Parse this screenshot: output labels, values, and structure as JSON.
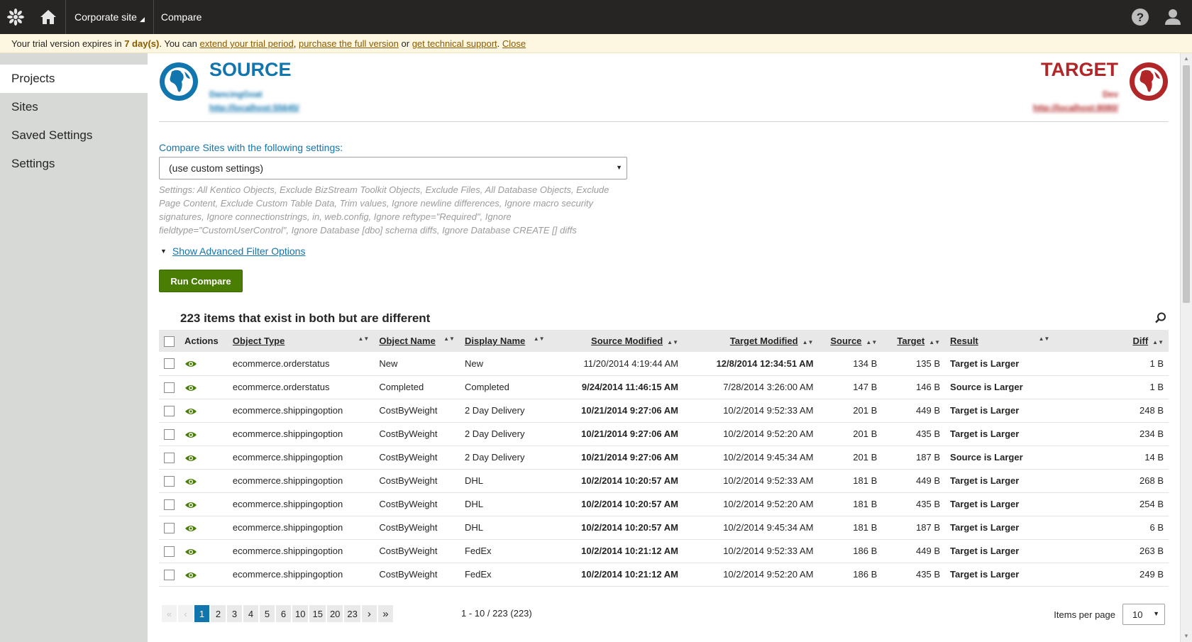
{
  "topbar": {
    "logo_icon": "kentico-logo-icon",
    "home_icon": "home-icon",
    "site_label": "Corporate site",
    "app_label": "Compare",
    "help_icon": "help-icon",
    "user_icon": "user-icon"
  },
  "trial": {
    "prefix": "Your trial version expires in ",
    "days": "7 day(s)",
    "middle": ". You can ",
    "link_extend": "extend your trial period",
    "sep1": ", ",
    "link_purchase": "purchase the full version",
    "sep2": " or ",
    "link_support": "get technical support",
    "sep3": ". ",
    "link_close": "Close"
  },
  "sidebar": {
    "items": [
      {
        "label": "Projects",
        "active": true
      },
      {
        "label": "Sites",
        "active": false
      },
      {
        "label": "Saved Settings",
        "active": false
      },
      {
        "label": "Settings",
        "active": false
      }
    ]
  },
  "source": {
    "title": "SOURCE",
    "name": "DancingGoat",
    "url": "http://localhost:55645/",
    "color": "#1175ae"
  },
  "target": {
    "title": "TARGET",
    "name": "Dev",
    "url": "http://localhost:8080/",
    "color": "#b12628"
  },
  "compare": {
    "label": "Compare Sites with the following settings:",
    "selected": "(use custom settings)",
    "settings_text": "Settings: All Kentico Objects, Exclude BizStream Toolkit Objects, Exclude Files, All Database Objects, Exclude Page Content, Exclude Custom Table Data, Trim values, Ignore newline differences, Ignore macro security signatures, Ignore connectionstrings, in, web.config, Ignore reftype=\"Required\", Ignore fieldtype=\"CustomUserControl\", Ignore Database [dbo] schema diffs, Ignore Database CREATE [] diffs",
    "advanced_link": "Show Advanced Filter Options",
    "run_button": "Run Compare"
  },
  "grid": {
    "title": "223 items that exist in both but are different",
    "columns": {
      "actions": "Actions",
      "object_type": "Object Type",
      "object_name": "Object Name",
      "display_name": "Display Name",
      "source_modified": "Source Modified",
      "target_modified": "Target Modified",
      "source": "Source",
      "target": "Target",
      "result": "Result",
      "diff": "Diff"
    },
    "rows": [
      {
        "object_type": "ecommerce.orderstatus",
        "object_name": "New",
        "display_name": "New",
        "source_modified": "11/20/2014 4:19:44 AM",
        "target_modified": "12/8/2014 12:34:51 AM",
        "newer": "target",
        "source": "134 B",
        "target": "135 B",
        "result": "Target is Larger",
        "diff": "1 B"
      },
      {
        "object_type": "ecommerce.orderstatus",
        "object_name": "Completed",
        "display_name": "Completed",
        "source_modified": "9/24/2014 11:46:15 AM",
        "target_modified": "7/28/2014 3:26:00 AM",
        "newer": "source",
        "source": "147 B",
        "target": "146 B",
        "result": "Source is Larger",
        "diff": "1 B"
      },
      {
        "object_type": "ecommerce.shippingoption",
        "object_name": "CostByWeight",
        "display_name": "2 Day Delivery",
        "source_modified": "10/21/2014 9:27:06 AM",
        "target_modified": "10/2/2014 9:52:33 AM",
        "newer": "source",
        "source": "201 B",
        "target": "449 B",
        "result": "Target is Larger",
        "diff": "248 B"
      },
      {
        "object_type": "ecommerce.shippingoption",
        "object_name": "CostByWeight",
        "display_name": "2 Day Delivery",
        "source_modified": "10/21/2014 9:27:06 AM",
        "target_modified": "10/2/2014 9:52:20 AM",
        "newer": "source",
        "source": "201 B",
        "target": "435 B",
        "result": "Target is Larger",
        "diff": "234 B"
      },
      {
        "object_type": "ecommerce.shippingoption",
        "object_name": "CostByWeight",
        "display_name": "2 Day Delivery",
        "source_modified": "10/21/2014 9:27:06 AM",
        "target_modified": "10/2/2014 9:45:34 AM",
        "newer": "source",
        "source": "201 B",
        "target": "187 B",
        "result": "Source is Larger",
        "diff": "14 B"
      },
      {
        "object_type": "ecommerce.shippingoption",
        "object_name": "CostByWeight",
        "display_name": "DHL",
        "source_modified": "10/2/2014 10:20:57 AM",
        "target_modified": "10/2/2014 9:52:33 AM",
        "newer": "source",
        "source": "181 B",
        "target": "449 B",
        "result": "Target is Larger",
        "diff": "268 B"
      },
      {
        "object_type": "ecommerce.shippingoption",
        "object_name": "CostByWeight",
        "display_name": "DHL",
        "source_modified": "10/2/2014 10:20:57 AM",
        "target_modified": "10/2/2014 9:52:20 AM",
        "newer": "source",
        "source": "181 B",
        "target": "435 B",
        "result": "Target is Larger",
        "diff": "254 B"
      },
      {
        "object_type": "ecommerce.shippingoption",
        "object_name": "CostByWeight",
        "display_name": "DHL",
        "source_modified": "10/2/2014 10:20:57 AM",
        "target_modified": "10/2/2014 9:45:34 AM",
        "newer": "source",
        "source": "181 B",
        "target": "187 B",
        "result": "Target is Larger",
        "diff": "6 B"
      },
      {
        "object_type": "ecommerce.shippingoption",
        "object_name": "CostByWeight",
        "display_name": "FedEx",
        "source_modified": "10/2/2014 10:21:12 AM",
        "target_modified": "10/2/2014 9:52:33 AM",
        "newer": "source",
        "source": "186 B",
        "target": "449 B",
        "result": "Target is Larger",
        "diff": "263 B"
      },
      {
        "object_type": "ecommerce.shippingoption",
        "object_name": "CostByWeight",
        "display_name": "FedEx",
        "source_modified": "10/2/2014 10:21:12 AM",
        "target_modified": "10/2/2014 9:52:20 AM",
        "newer": "source",
        "source": "186 B",
        "target": "435 B",
        "result": "Target is Larger",
        "diff": "249 B"
      }
    ]
  },
  "pager": {
    "pages": [
      "1",
      "2",
      "3",
      "4",
      "5",
      "6",
      "10",
      "15",
      "20",
      "23"
    ],
    "current": "1",
    "info": "1 - 10 / 223 (223)",
    "items_per_page_label": "Items per page",
    "items_per_page": "10"
  },
  "colors": {
    "accent_blue": "#1175ae",
    "accent_red": "#b12628",
    "run_green": "#497d04",
    "eye_green": "#497d04"
  }
}
